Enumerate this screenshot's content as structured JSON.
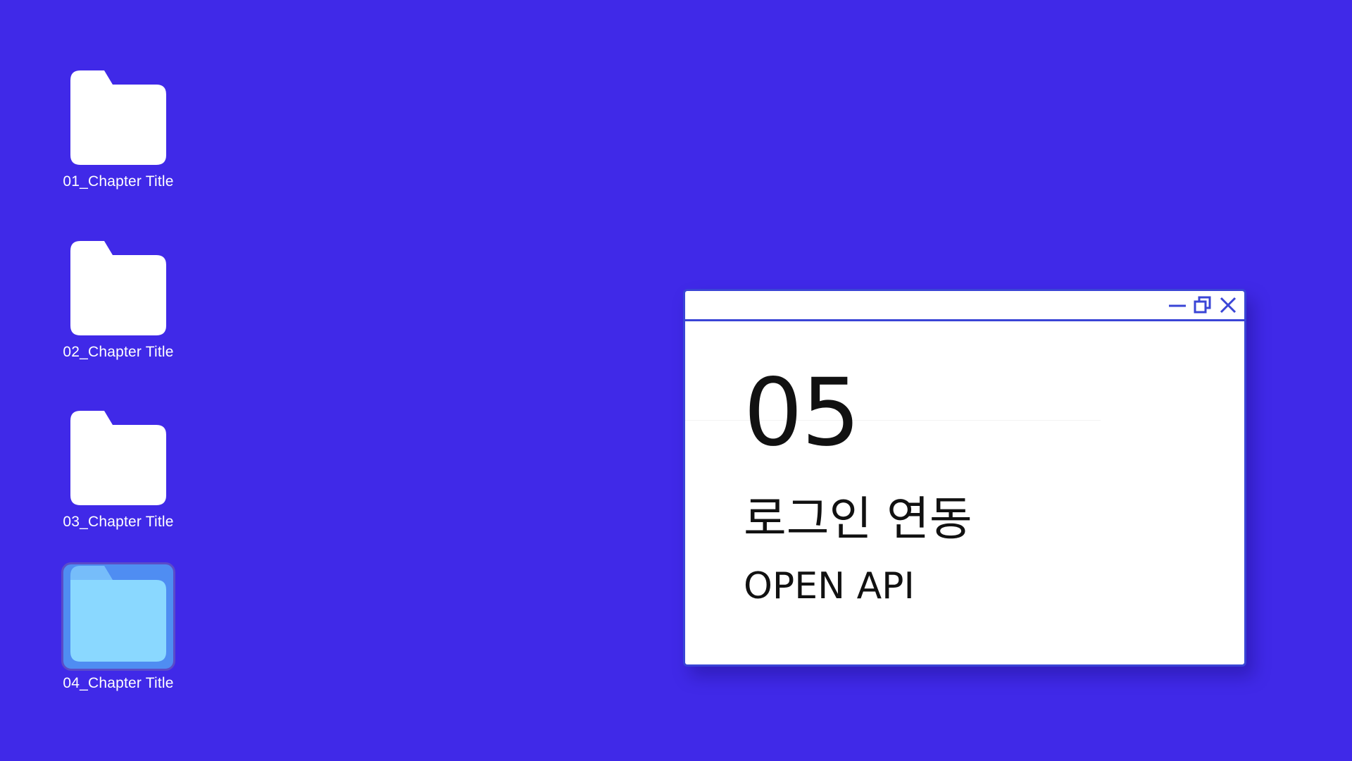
{
  "desktop": {
    "background_color": "#4029E8",
    "icons": [
      {
        "label": "01_Chapter Title",
        "icon": "folder-icon",
        "selected": false
      },
      {
        "label": "02_Chapter Title",
        "icon": "folder-icon",
        "selected": false
      },
      {
        "label": "03_Chapter Title",
        "icon": "folder-icon",
        "selected": false
      },
      {
        "label": "04_Chapter Title",
        "icon": "folder-icon",
        "selected": true
      }
    ]
  },
  "window": {
    "border_color": "#3A45D6",
    "controls": {
      "minimize_icon": "minimize-icon",
      "maximize_icon": "restore-icon",
      "close_icon": "close-icon"
    },
    "content": {
      "number": "05",
      "title": "로그인 연동",
      "subtitle": "OPEN API"
    }
  },
  "colors": {
    "folder_default": "#FFFFFF",
    "folder_selected_fill": "#8AD8FF",
    "folder_selected_tab": "#4F8DF2",
    "selection_background": "#4F8DF2",
    "accent": "#3A45D6"
  }
}
